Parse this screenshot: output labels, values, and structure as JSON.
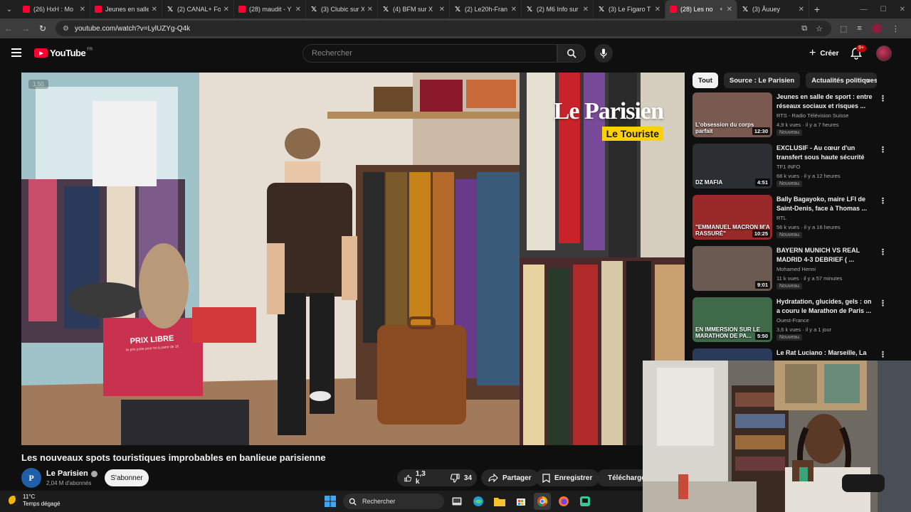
{
  "browser": {
    "tabs": [
      {
        "label": "(26) HxH : Mo",
        "icon": "youtube-icon",
        "active": false
      },
      {
        "label": "Jeunes en salle",
        "icon": "youtube-icon",
        "active": false
      },
      {
        "label": "(2) CANAL+ Fo",
        "icon": "x-icon",
        "active": false
      },
      {
        "label": "(28) maudit - Y",
        "icon": "youtube-icon",
        "active": false
      },
      {
        "label": "(3) Clubic sur X",
        "icon": "x-icon",
        "active": false
      },
      {
        "label": "(4) BFM sur X",
        "icon": "x-icon",
        "active": false
      },
      {
        "label": "(2) Le20h-Fran",
        "icon": "x-icon",
        "active": false
      },
      {
        "label": "(2) M6 Info sur",
        "icon": "x-icon",
        "active": false
      },
      {
        "label": "(3) Le Figaro T",
        "icon": "x-icon",
        "active": false
      },
      {
        "label": "(28) Les no",
        "icon": "youtube-icon",
        "active": true
      },
      {
        "label": "(3) Âuuey",
        "icon": "x-icon",
        "active": false
      }
    ],
    "url": "youtube.com/watch?v=LylUZYg-Q4k"
  },
  "youtube": {
    "logo_text": "YouTube",
    "logo_region": "FR",
    "search_placeholder": "Rechercher",
    "create_label": "Créer",
    "notif_count": "9+"
  },
  "video": {
    "speed_label": "1.50",
    "brand_name": "Le Parisien",
    "brand_series": "Le Touriste",
    "sign_text": "PRIX LIBRE",
    "sign_small": "le prix juste pour toi à partir de 1€",
    "title": "Les nouveaux spots touristiques improbables en banlieue parisienne",
    "channel": "Le Parisien",
    "subscribers": "2,04 M d'abonnés",
    "subscribe_label": "S'abonner",
    "likes": "1,3 k",
    "dislikes": "34",
    "share_label": "Partager",
    "save_label": "Enregistrer",
    "download_label": "Télécharger"
  },
  "sidebar": {
    "chips": [
      "Tout",
      "Source : Le Parisien",
      "Actualités politiques"
    ],
    "recommendations": [
      {
        "title": "Jeunes en salle de sport : entre réseaux sociaux et risques ...",
        "channel": "RTS - Radio Télévision Suisse",
        "meta": "4,9 k vues · il y a 7 heures",
        "badge": "Nouveau",
        "duration": "12:30",
        "caption": "L'obsession du corps parfait",
        "thumb_color": "#7a5a50"
      },
      {
        "title": "EXCLUSIF - Au cœur d'un transfert sous haute sécurité d...",
        "channel": "TF1 INFO",
        "meta": "68 k vues · il y a 12 heures",
        "badge": "Nouveau",
        "duration": "4:51",
        "caption": "DZ MAFIA",
        "thumb_color": "#2b2f33"
      },
      {
        "title": "Bally Bagayoko, maire LFI de Saint-Denis, face à Thomas ...",
        "channel": "RTL",
        "meta": "56 k vues · il y a 16 heures",
        "badge": "Nouveau",
        "duration": "10:25",
        "caption": "\"EMMANUEL MACRON M'A RASSURÉ\"",
        "thumb_color": "#9a2a2a"
      },
      {
        "title": "BAYERN MUNICH VS REAL MADRID 4-3 DEBRIEF ( ...",
        "channel": "Mohamed Henni",
        "meta": "11 k vues · il y a 57 minutes",
        "badge": "Nouveau",
        "duration": "9:01",
        "caption": "",
        "thumb_color": "#6b5a52"
      },
      {
        "title": "Hydratation, glucides, gels : on a couru le Marathon de Paris ...",
        "channel": "Ouest-France",
        "meta": "3,6 k vues · il y a 1 jour",
        "badge": "Nouveau",
        "duration": "5:50",
        "caption": "EN IMMERSION SUR LE MARATHON DE PA...",
        "thumb_color": "#3e6a4a"
      },
      {
        "title": "Le Rat Luciano : Marseille, La",
        "channel": "",
        "meta": "",
        "badge": "",
        "duration": "",
        "caption": "",
        "thumb_color": "#2a3a5a"
      }
    ]
  },
  "taskbar": {
    "temperature": "11°C",
    "condition": "Temps dégagé",
    "search_label": "Rechercher"
  }
}
